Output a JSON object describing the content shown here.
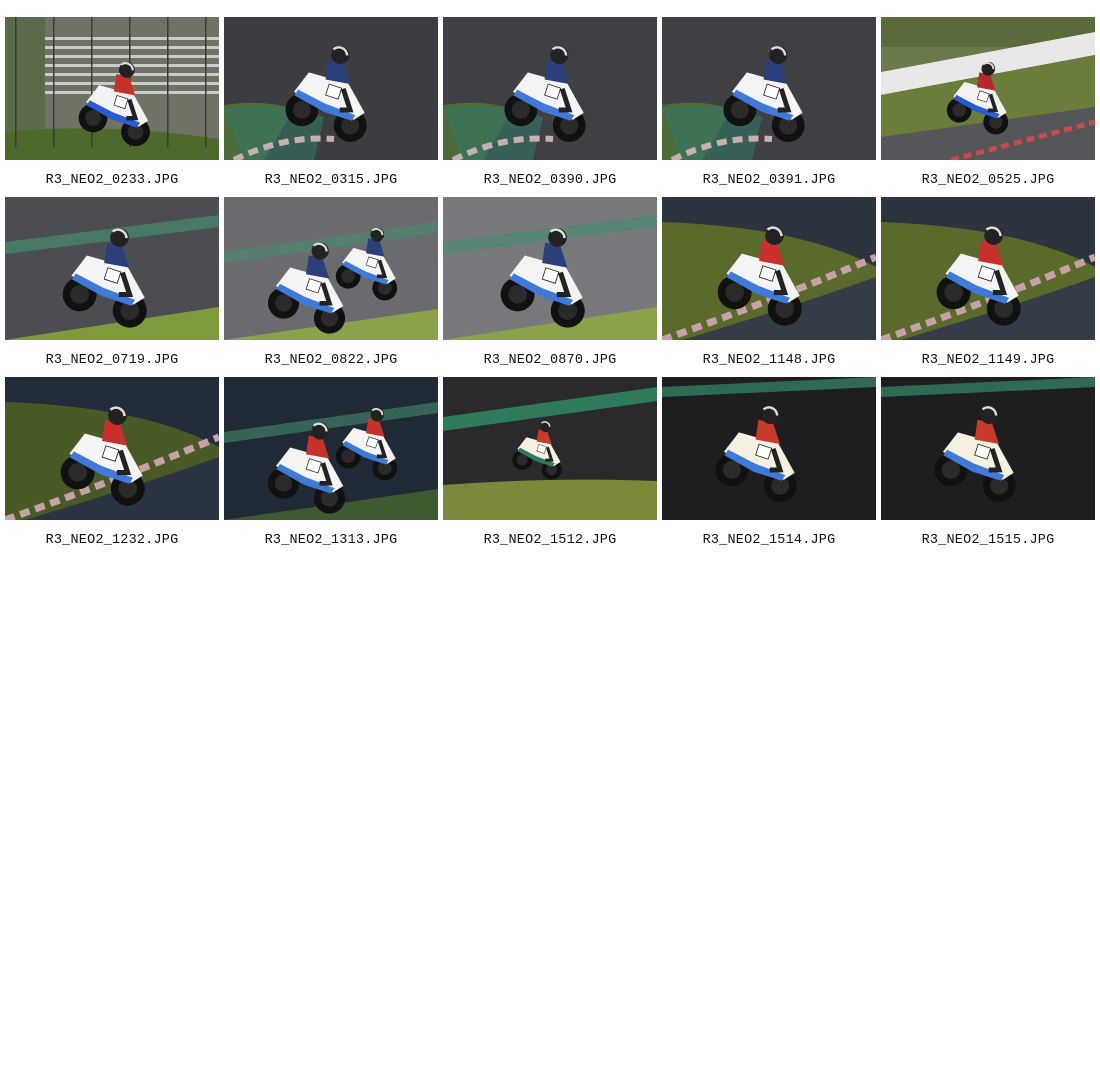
{
  "gallery": {
    "items": [
      {
        "filename": "R3_NEO2_0233.JPG",
        "scene": "grandstand",
        "palette": {
          "bg": "#6f7366",
          "track": "#8e8f8a",
          "grass": "#4d6a2c",
          "bike": "#f2f2f2",
          "accent": "#2a5bd0",
          "rider": "#c8302c"
        }
      },
      {
        "filename": "R3_NEO2_0315.JPG",
        "scene": "curb-left",
        "palette": {
          "bg": "#3c3d41",
          "track": "#46474b",
          "grass": "#4e6b3a",
          "bike": "#f4f4f4",
          "accent": "#3f7ad8",
          "rider": "#2b3f7a"
        }
      },
      {
        "filename": "R3_NEO2_0390.JPG",
        "scene": "curb-left",
        "palette": {
          "bg": "#3f4044",
          "track": "#4a4b4f",
          "grass": "#4e6b3a",
          "bike": "#f4f4f4",
          "accent": "#3f7ad8",
          "rider": "#2b3f7a"
        }
      },
      {
        "filename": "R3_NEO2_0391.JPG",
        "scene": "curb-left",
        "palette": {
          "bg": "#3f4044",
          "track": "#4a4b4f",
          "grass": "#4e6b3a",
          "bike": "#f4f4f4",
          "accent": "#3f7ad8",
          "rider": "#2b3f7a"
        }
      },
      {
        "filename": "R3_NEO2_0525.JPG",
        "scene": "barrier",
        "palette": {
          "bg": "#6a7a4a",
          "track": "#55565a",
          "grass": "#6a7d3a",
          "bike": "#f2f2f2",
          "accent": "#2a5bd0",
          "rider": "#b22a2a"
        }
      },
      {
        "filename": "R3_NEO2_0719.JPG",
        "scene": "green-stripe",
        "palette": {
          "bg": "#4c4d52",
          "track": "#56575c",
          "grass": "#7e9a3c",
          "bike": "#f4f4f4",
          "accent": "#3f7ad8",
          "rider": "#2b3f7a"
        }
      },
      {
        "filename": "R3_NEO2_0822.JPG",
        "scene": "two-riders",
        "palette": {
          "bg": "#6a6b6f",
          "track": "#76777b",
          "grass": "#8aa24a",
          "bike": "#f4f4f4",
          "accent": "#3f7ad8",
          "rider": "#2b3f7a"
        }
      },
      {
        "filename": "R3_NEO2_0870.JPG",
        "scene": "green-stripe",
        "palette": {
          "bg": "#78797d",
          "track": "#85868a",
          "grass": "#8aa24a",
          "bike": "#f4f4f4",
          "accent": "#3f7ad8",
          "rider": "#2b3f7a"
        }
      },
      {
        "filename": "R3_NEO2_1148.JPG",
        "scene": "grass-curb",
        "palette": {
          "bg": "#2c3440",
          "track": "#343c48",
          "grass": "#5a6a2a",
          "bike": "#f4f4f4",
          "accent": "#3f7ad8",
          "rider": "#c8302c"
        }
      },
      {
        "filename": "R3_NEO2_1149.JPG",
        "scene": "grass-curb",
        "palette": {
          "bg": "#2c3440",
          "track": "#343c48",
          "grass": "#5a6a2a",
          "bike": "#f4f4f4",
          "accent": "#3f7ad8",
          "rider": "#c8302c"
        }
      },
      {
        "filename": "R3_NEO2_1232.JPG",
        "scene": "grass-curb",
        "palette": {
          "bg": "#232c3a",
          "track": "#2a3442",
          "grass": "#4a5a26",
          "bike": "#f4f4f4",
          "accent": "#3f7ad8",
          "rider": "#c8302c"
        }
      },
      {
        "filename": "R3_NEO2_1313.JPG",
        "scene": "two-riders",
        "palette": {
          "bg": "#1f2a36",
          "track": "#263240",
          "grass": "#3f5a30",
          "bike": "#f4f4f4",
          "accent": "#3f7ad8",
          "rider": "#c8302c"
        }
      },
      {
        "filename": "R3_NEO2_1512.JPG",
        "scene": "sunset-small",
        "palette": {
          "bg": "#2a2a2c",
          "track": "#303032",
          "grass": "#7a8a3a",
          "bike": "#f6f0e0",
          "accent": "#2f7a5a",
          "rider": "#c83a2a"
        }
      },
      {
        "filename": "R3_NEO2_1514.JPG",
        "scene": "sunset",
        "palette": {
          "bg": "#1e1e20",
          "track": "#262628",
          "grass": "#2f6a52",
          "bike": "#f6f0e0",
          "accent": "#3f7ad8",
          "rider": "#c83a2a"
        }
      },
      {
        "filename": "R3_NEO2_1515.JPG",
        "scene": "sunset",
        "palette": {
          "bg": "#1e1e20",
          "track": "#262628",
          "grass": "#2f6a52",
          "bike": "#f6f0e0",
          "accent": "#3f7ad8",
          "rider": "#c83a2a"
        }
      }
    ]
  }
}
